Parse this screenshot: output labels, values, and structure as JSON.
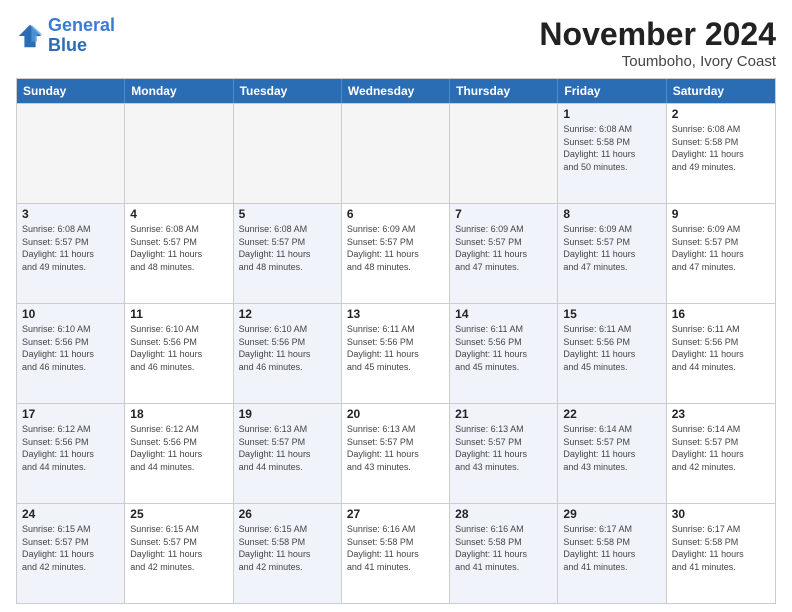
{
  "logo": {
    "line1": "General",
    "line2": "Blue"
  },
  "title": "November 2024",
  "subtitle": "Toumboho, Ivory Coast",
  "days_of_week": [
    "Sunday",
    "Monday",
    "Tuesday",
    "Wednesday",
    "Thursday",
    "Friday",
    "Saturday"
  ],
  "rows": [
    [
      {
        "day": "",
        "info": "",
        "empty": true
      },
      {
        "day": "",
        "info": "",
        "empty": true
      },
      {
        "day": "",
        "info": "",
        "empty": true
      },
      {
        "day": "",
        "info": "",
        "empty": true
      },
      {
        "day": "",
        "info": "",
        "empty": true
      },
      {
        "day": "1",
        "info": "Sunrise: 6:08 AM\nSunset: 5:58 PM\nDaylight: 11 hours\nand 50 minutes.",
        "shaded": true
      },
      {
        "day": "2",
        "info": "Sunrise: 6:08 AM\nSunset: 5:58 PM\nDaylight: 11 hours\nand 49 minutes."
      }
    ],
    [
      {
        "day": "3",
        "info": "Sunrise: 6:08 AM\nSunset: 5:57 PM\nDaylight: 11 hours\nand 49 minutes.",
        "shaded": true
      },
      {
        "day": "4",
        "info": "Sunrise: 6:08 AM\nSunset: 5:57 PM\nDaylight: 11 hours\nand 48 minutes."
      },
      {
        "day": "5",
        "info": "Sunrise: 6:08 AM\nSunset: 5:57 PM\nDaylight: 11 hours\nand 48 minutes.",
        "shaded": true
      },
      {
        "day": "6",
        "info": "Sunrise: 6:09 AM\nSunset: 5:57 PM\nDaylight: 11 hours\nand 48 minutes."
      },
      {
        "day": "7",
        "info": "Sunrise: 6:09 AM\nSunset: 5:57 PM\nDaylight: 11 hours\nand 47 minutes.",
        "shaded": true
      },
      {
        "day": "8",
        "info": "Sunrise: 6:09 AM\nSunset: 5:57 PM\nDaylight: 11 hours\nand 47 minutes.",
        "shaded": true
      },
      {
        "day": "9",
        "info": "Sunrise: 6:09 AM\nSunset: 5:57 PM\nDaylight: 11 hours\nand 47 minutes."
      }
    ],
    [
      {
        "day": "10",
        "info": "Sunrise: 6:10 AM\nSunset: 5:56 PM\nDaylight: 11 hours\nand 46 minutes.",
        "shaded": true
      },
      {
        "day": "11",
        "info": "Sunrise: 6:10 AM\nSunset: 5:56 PM\nDaylight: 11 hours\nand 46 minutes."
      },
      {
        "day": "12",
        "info": "Sunrise: 6:10 AM\nSunset: 5:56 PM\nDaylight: 11 hours\nand 46 minutes.",
        "shaded": true
      },
      {
        "day": "13",
        "info": "Sunrise: 6:11 AM\nSunset: 5:56 PM\nDaylight: 11 hours\nand 45 minutes."
      },
      {
        "day": "14",
        "info": "Sunrise: 6:11 AM\nSunset: 5:56 PM\nDaylight: 11 hours\nand 45 minutes.",
        "shaded": true
      },
      {
        "day": "15",
        "info": "Sunrise: 6:11 AM\nSunset: 5:56 PM\nDaylight: 11 hours\nand 45 minutes.",
        "shaded": true
      },
      {
        "day": "16",
        "info": "Sunrise: 6:11 AM\nSunset: 5:56 PM\nDaylight: 11 hours\nand 44 minutes."
      }
    ],
    [
      {
        "day": "17",
        "info": "Sunrise: 6:12 AM\nSunset: 5:56 PM\nDaylight: 11 hours\nand 44 minutes.",
        "shaded": true
      },
      {
        "day": "18",
        "info": "Sunrise: 6:12 AM\nSunset: 5:56 PM\nDaylight: 11 hours\nand 44 minutes."
      },
      {
        "day": "19",
        "info": "Sunrise: 6:13 AM\nSunset: 5:57 PM\nDaylight: 11 hours\nand 44 minutes.",
        "shaded": true
      },
      {
        "day": "20",
        "info": "Sunrise: 6:13 AM\nSunset: 5:57 PM\nDaylight: 11 hours\nand 43 minutes."
      },
      {
        "day": "21",
        "info": "Sunrise: 6:13 AM\nSunset: 5:57 PM\nDaylight: 11 hours\nand 43 minutes.",
        "shaded": true
      },
      {
        "day": "22",
        "info": "Sunrise: 6:14 AM\nSunset: 5:57 PM\nDaylight: 11 hours\nand 43 minutes.",
        "shaded": true
      },
      {
        "day": "23",
        "info": "Sunrise: 6:14 AM\nSunset: 5:57 PM\nDaylight: 11 hours\nand 42 minutes."
      }
    ],
    [
      {
        "day": "24",
        "info": "Sunrise: 6:15 AM\nSunset: 5:57 PM\nDaylight: 11 hours\nand 42 minutes.",
        "shaded": true
      },
      {
        "day": "25",
        "info": "Sunrise: 6:15 AM\nSunset: 5:57 PM\nDaylight: 11 hours\nand 42 minutes."
      },
      {
        "day": "26",
        "info": "Sunrise: 6:15 AM\nSunset: 5:58 PM\nDaylight: 11 hours\nand 42 minutes.",
        "shaded": true
      },
      {
        "day": "27",
        "info": "Sunrise: 6:16 AM\nSunset: 5:58 PM\nDaylight: 11 hours\nand 41 minutes."
      },
      {
        "day": "28",
        "info": "Sunrise: 6:16 AM\nSunset: 5:58 PM\nDaylight: 11 hours\nand 41 minutes.",
        "shaded": true
      },
      {
        "day": "29",
        "info": "Sunrise: 6:17 AM\nSunset: 5:58 PM\nDaylight: 11 hours\nand 41 minutes.",
        "shaded": true
      },
      {
        "day": "30",
        "info": "Sunrise: 6:17 AM\nSunset: 5:58 PM\nDaylight: 11 hours\nand 41 minutes."
      }
    ]
  ]
}
